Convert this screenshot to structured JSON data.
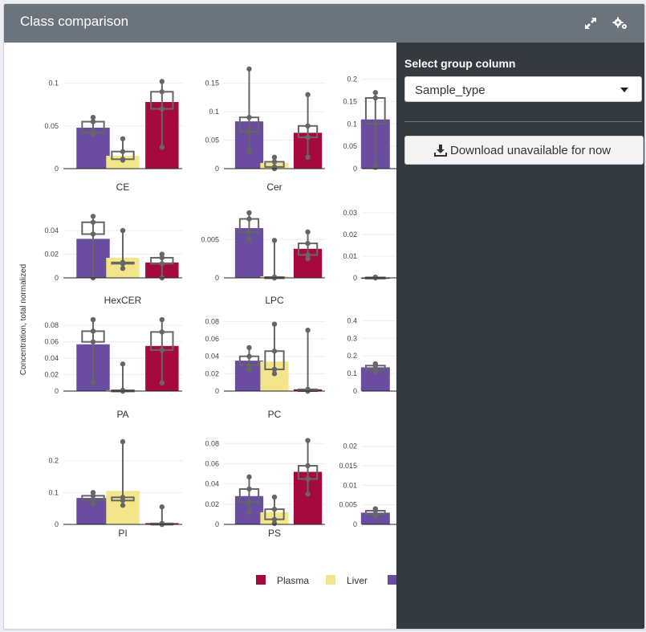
{
  "header": {
    "title": "Class comparison",
    "expand_icon": "expand-arrows-icon",
    "settings_icon": "gears-icon"
  },
  "sidebar": {
    "select_label": "Select group column",
    "select_value": "Sample_type",
    "download_label": "Download unavailable for now",
    "download_icon": "download-icon"
  },
  "colors": {
    "Plasma": "#a50a3f",
    "Liver": "#f3e68a",
    "Other": "#6a4ca0",
    "box": "#666666"
  },
  "chart_data": {
    "type": "bar",
    "ylabel": "Concentration, total normalized",
    "legend": {
      "placement": "bottom",
      "entries": [
        "Plasma",
        "Liver"
      ]
    },
    "panels": [
      {
        "name": "CE",
        "ticks": [
          "0",
          "0.05",
          "0.1"
        ],
        "ymax": 0.11,
        "tickvals": [
          0,
          0.05,
          0.1
        ],
        "bars": [
          {
            "group": "Other",
            "value": 0.048,
            "box": [
              0.042,
              0.055
            ],
            "whisker": [
              0.04,
              0.06
            ]
          },
          {
            "group": "Liver",
            "value": 0.015,
            "box": [
              0.011,
              0.02
            ],
            "whisker": [
              0.01,
              0.035
            ]
          },
          {
            "group": "Plasma",
            "value": 0.078,
            "box": [
              0.07,
              0.09
            ],
            "whisker": [
              0.025,
              0.102
            ]
          }
        ]
      },
      {
        "name": "Cer",
        "ticks": [
          "0",
          "0.05",
          "0.1",
          "0.15"
        ],
        "ymax": 0.165,
        "tickvals": [
          0,
          0.05,
          0.1,
          0.15
        ],
        "bars": [
          {
            "group": "Other",
            "value": 0.083,
            "box": [
              0.065,
              0.09
            ],
            "whisker": [
              0.03,
              0.175
            ]
          },
          {
            "group": "Liver",
            "value": 0.01,
            "box": [
              0.003,
              0.012
            ],
            "whisker": [
              0,
              0.02
            ]
          },
          {
            "group": "Plasma",
            "value": 0.063,
            "box": [
              0.055,
              0.075
            ],
            "whisker": [
              0.02,
              0.13
            ]
          }
        ]
      },
      {
        "name": "",
        "ticks": [
          "0",
          "0.05",
          "0.1",
          "0.15",
          "0.2"
        ],
        "ymax": 0.21,
        "tickvals": [
          0,
          0.05,
          0.1,
          0.15,
          0.2
        ],
        "bars": [
          {
            "group": "Other",
            "value": 0.11,
            "box": [
              0.1,
              0.158
            ],
            "whisker": [
              0.003,
              0.17
            ]
          }
        ]
      },
      {
        "name": "HexCER",
        "ticks": [
          "0",
          "0.02",
          "0.04"
        ],
        "ymax": 0.055,
        "tickvals": [
          0,
          0.02,
          0.04
        ],
        "bars": [
          {
            "group": "Other",
            "value": 0.033,
            "box": [
              0.037,
              0.047
            ],
            "whisker": [
              0,
              0.052
            ]
          },
          {
            "group": "Liver",
            "value": 0.017,
            "box": [
              0.012,
              0.013
            ],
            "whisker": [
              0.008,
              0.04
            ]
          },
          {
            "group": "Plasma",
            "value": 0.013,
            "box": [
              0.012,
              0.017
            ],
            "whisker": [
              0,
              0.02
            ]
          }
        ]
      },
      {
        "name": "LPC",
        "ticks": [
          "0",
          "0.005"
        ],
        "ymax": 0.0085,
        "tickvals": [
          0,
          0.005
        ],
        "bars": [
          {
            "group": "Other",
            "value": 0.0065,
            "box": [
              0.006,
              0.0077
            ],
            "whisker": [
              0.005,
              0.0085
            ]
          },
          {
            "group": "Liver",
            "value": 0.0002,
            "box": [
              0,
              0.0001
            ],
            "whisker": [
              0,
              0.0049
            ]
          },
          {
            "group": "Plasma",
            "value": 0.0038,
            "box": [
              0.003,
              0.0045
            ],
            "whisker": [
              0.0025,
              0.006
            ]
          }
        ]
      },
      {
        "name": "",
        "ticks": [
          "0",
          "0.01",
          "0.02",
          "0.03"
        ],
        "ymax": 0.03,
        "tickvals": [
          0,
          0.01,
          0.02,
          0.03
        ],
        "bars": [
          {
            "group": "Other",
            "value": 0.0001,
            "box": [
              0,
              0.0002
            ],
            "whisker": [
              0,
              0.0003
            ]
          }
        ]
      },
      {
        "name": "PA",
        "ticks": [
          "0",
          "0.02",
          "0.04",
          "0.06",
          "0.08"
        ],
        "ymax": 0.09,
        "tickvals": [
          0,
          0.02,
          0.04,
          0.06,
          0.08
        ],
        "bars": [
          {
            "group": "Other",
            "value": 0.057,
            "box": [
              0.06,
              0.073
            ],
            "whisker": [
              0.01,
              0.087
            ]
          },
          {
            "group": "Liver",
            "value": 0.001,
            "box": [
              0,
              0.001
            ],
            "whisker": [
              0,
              0.033
            ]
          },
          {
            "group": "Plasma",
            "value": 0.055,
            "box": [
              0.05,
              0.072
            ],
            "whisker": [
              0.01,
              0.087
            ]
          }
        ]
      },
      {
        "name": "PC",
        "ticks": [
          "0",
          "0.02",
          "0.04",
          "0.06",
          "0.08"
        ],
        "ymax": 0.085,
        "tickvals": [
          0,
          0.02,
          0.04,
          0.06,
          0.08
        ],
        "bars": [
          {
            "group": "Other",
            "value": 0.035,
            "box": [
              0.03,
              0.04
            ],
            "whisker": [
              0.025,
              0.05
            ]
          },
          {
            "group": "Liver",
            "value": 0.034,
            "box": [
              0.025,
              0.046
            ],
            "whisker": [
              0.02,
              0.077
            ]
          },
          {
            "group": "Plasma",
            "value": 0.002,
            "box": [
              0,
              0.002
            ],
            "whisker": [
              0,
              0.07
            ]
          }
        ]
      },
      {
        "name": "",
        "ticks": [
          "0",
          "0.1",
          "0.2",
          "0.3",
          "0.4"
        ],
        "ymax": 0.42,
        "tickvals": [
          0,
          0.1,
          0.2,
          0.3,
          0.4
        ],
        "bars": [
          {
            "group": "Other",
            "value": 0.135,
            "box": [
              0.12,
              0.145
            ],
            "whisker": [
              0.11,
              0.155
            ]
          }
        ]
      },
      {
        "name": "PI",
        "ticks": [
          "0",
          "0.1",
          "0.2"
        ],
        "ymax": 0.27,
        "tickvals": [
          0,
          0.1,
          0.2
        ],
        "bars": [
          {
            "group": "Other",
            "value": 0.083,
            "box": [
              0.075,
              0.09
            ],
            "whisker": [
              0.065,
              0.1
            ]
          },
          {
            "group": "Liver",
            "value": 0.105,
            "box": [
              0.075,
              0.085
            ],
            "whisker": [
              0.06,
              0.26
            ]
          },
          {
            "group": "Plasma",
            "value": 0.004,
            "box": [
              0,
              0.003
            ],
            "whisker": [
              0,
              0.055
            ]
          }
        ]
      },
      {
        "name": "PS",
        "ticks": [
          "0",
          "0.02",
          "0.04",
          "0.06",
          "0.08"
        ],
        "ymax": 0.085,
        "tickvals": [
          0,
          0.02,
          0.04,
          0.06,
          0.08
        ],
        "bars": [
          {
            "group": "Other",
            "value": 0.028,
            "box": [
              0.022,
              0.035
            ],
            "whisker": [
              0.012,
              0.047
            ]
          },
          {
            "group": "Liver",
            "value": 0.012,
            "box": [
              0.005,
              0.015
            ],
            "whisker": [
              0.001,
              0.027
            ]
          },
          {
            "group": "Plasma",
            "value": 0.052,
            "box": [
              0.045,
              0.058
            ],
            "whisker": [
              0.03,
              0.083
            ]
          }
        ]
      },
      {
        "name": "",
        "ticks": [
          "0",
          "0.005",
          "0.01",
          "0.015",
          "0.02"
        ],
        "ymax": 0.022,
        "tickvals": [
          0,
          0.005,
          0.01,
          0.015,
          0.02
        ],
        "bars": [
          {
            "group": "Other",
            "value": 0.003,
            "box": [
              0.0025,
              0.0035
            ],
            "whisker": [
              0.002,
              0.004
            ]
          }
        ]
      }
    ]
  }
}
